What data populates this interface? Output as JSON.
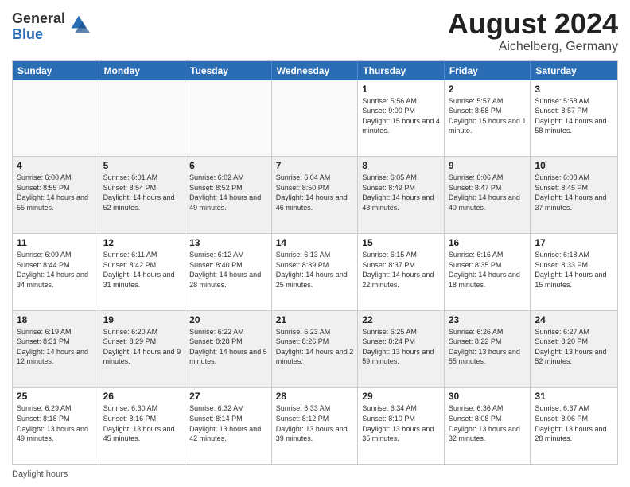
{
  "logo": {
    "general": "General",
    "blue": "Blue"
  },
  "title": {
    "month": "August 2024",
    "location": "Aichelberg, Germany"
  },
  "header_days": [
    "Sunday",
    "Monday",
    "Tuesday",
    "Wednesday",
    "Thursday",
    "Friday",
    "Saturday"
  ],
  "weeks": [
    [
      {
        "day": "",
        "info": ""
      },
      {
        "day": "",
        "info": ""
      },
      {
        "day": "",
        "info": ""
      },
      {
        "day": "",
        "info": ""
      },
      {
        "day": "1",
        "info": "Sunrise: 5:56 AM\nSunset: 9:00 PM\nDaylight: 15 hours and 4 minutes."
      },
      {
        "day": "2",
        "info": "Sunrise: 5:57 AM\nSunset: 8:58 PM\nDaylight: 15 hours and 1 minute."
      },
      {
        "day": "3",
        "info": "Sunrise: 5:58 AM\nSunset: 8:57 PM\nDaylight: 14 hours and 58 minutes."
      }
    ],
    [
      {
        "day": "4",
        "info": "Sunrise: 6:00 AM\nSunset: 8:55 PM\nDaylight: 14 hours and 55 minutes."
      },
      {
        "day": "5",
        "info": "Sunrise: 6:01 AM\nSunset: 8:54 PM\nDaylight: 14 hours and 52 minutes."
      },
      {
        "day": "6",
        "info": "Sunrise: 6:02 AM\nSunset: 8:52 PM\nDaylight: 14 hours and 49 minutes."
      },
      {
        "day": "7",
        "info": "Sunrise: 6:04 AM\nSunset: 8:50 PM\nDaylight: 14 hours and 46 minutes."
      },
      {
        "day": "8",
        "info": "Sunrise: 6:05 AM\nSunset: 8:49 PM\nDaylight: 14 hours and 43 minutes."
      },
      {
        "day": "9",
        "info": "Sunrise: 6:06 AM\nSunset: 8:47 PM\nDaylight: 14 hours and 40 minutes."
      },
      {
        "day": "10",
        "info": "Sunrise: 6:08 AM\nSunset: 8:45 PM\nDaylight: 14 hours and 37 minutes."
      }
    ],
    [
      {
        "day": "11",
        "info": "Sunrise: 6:09 AM\nSunset: 8:44 PM\nDaylight: 14 hours and 34 minutes."
      },
      {
        "day": "12",
        "info": "Sunrise: 6:11 AM\nSunset: 8:42 PM\nDaylight: 14 hours and 31 minutes."
      },
      {
        "day": "13",
        "info": "Sunrise: 6:12 AM\nSunset: 8:40 PM\nDaylight: 14 hours and 28 minutes."
      },
      {
        "day": "14",
        "info": "Sunrise: 6:13 AM\nSunset: 8:39 PM\nDaylight: 14 hours and 25 minutes."
      },
      {
        "day": "15",
        "info": "Sunrise: 6:15 AM\nSunset: 8:37 PM\nDaylight: 14 hours and 22 minutes."
      },
      {
        "day": "16",
        "info": "Sunrise: 6:16 AM\nSunset: 8:35 PM\nDaylight: 14 hours and 18 minutes."
      },
      {
        "day": "17",
        "info": "Sunrise: 6:18 AM\nSunset: 8:33 PM\nDaylight: 14 hours and 15 minutes."
      }
    ],
    [
      {
        "day": "18",
        "info": "Sunrise: 6:19 AM\nSunset: 8:31 PM\nDaylight: 14 hours and 12 minutes."
      },
      {
        "day": "19",
        "info": "Sunrise: 6:20 AM\nSunset: 8:29 PM\nDaylight: 14 hours and 9 minutes."
      },
      {
        "day": "20",
        "info": "Sunrise: 6:22 AM\nSunset: 8:28 PM\nDaylight: 14 hours and 5 minutes."
      },
      {
        "day": "21",
        "info": "Sunrise: 6:23 AM\nSunset: 8:26 PM\nDaylight: 14 hours and 2 minutes."
      },
      {
        "day": "22",
        "info": "Sunrise: 6:25 AM\nSunset: 8:24 PM\nDaylight: 13 hours and 59 minutes."
      },
      {
        "day": "23",
        "info": "Sunrise: 6:26 AM\nSunset: 8:22 PM\nDaylight: 13 hours and 55 minutes."
      },
      {
        "day": "24",
        "info": "Sunrise: 6:27 AM\nSunset: 8:20 PM\nDaylight: 13 hours and 52 minutes."
      }
    ],
    [
      {
        "day": "25",
        "info": "Sunrise: 6:29 AM\nSunset: 8:18 PM\nDaylight: 13 hours and 49 minutes."
      },
      {
        "day": "26",
        "info": "Sunrise: 6:30 AM\nSunset: 8:16 PM\nDaylight: 13 hours and 45 minutes."
      },
      {
        "day": "27",
        "info": "Sunrise: 6:32 AM\nSunset: 8:14 PM\nDaylight: 13 hours and 42 minutes."
      },
      {
        "day": "28",
        "info": "Sunrise: 6:33 AM\nSunset: 8:12 PM\nDaylight: 13 hours and 39 minutes."
      },
      {
        "day": "29",
        "info": "Sunrise: 6:34 AM\nSunset: 8:10 PM\nDaylight: 13 hours and 35 minutes."
      },
      {
        "day": "30",
        "info": "Sunrise: 6:36 AM\nSunset: 8:08 PM\nDaylight: 13 hours and 32 minutes."
      },
      {
        "day": "31",
        "info": "Sunrise: 6:37 AM\nSunset: 8:06 PM\nDaylight: 13 hours and 28 minutes."
      }
    ]
  ],
  "footer": {
    "daylight_hours": "Daylight hours"
  }
}
